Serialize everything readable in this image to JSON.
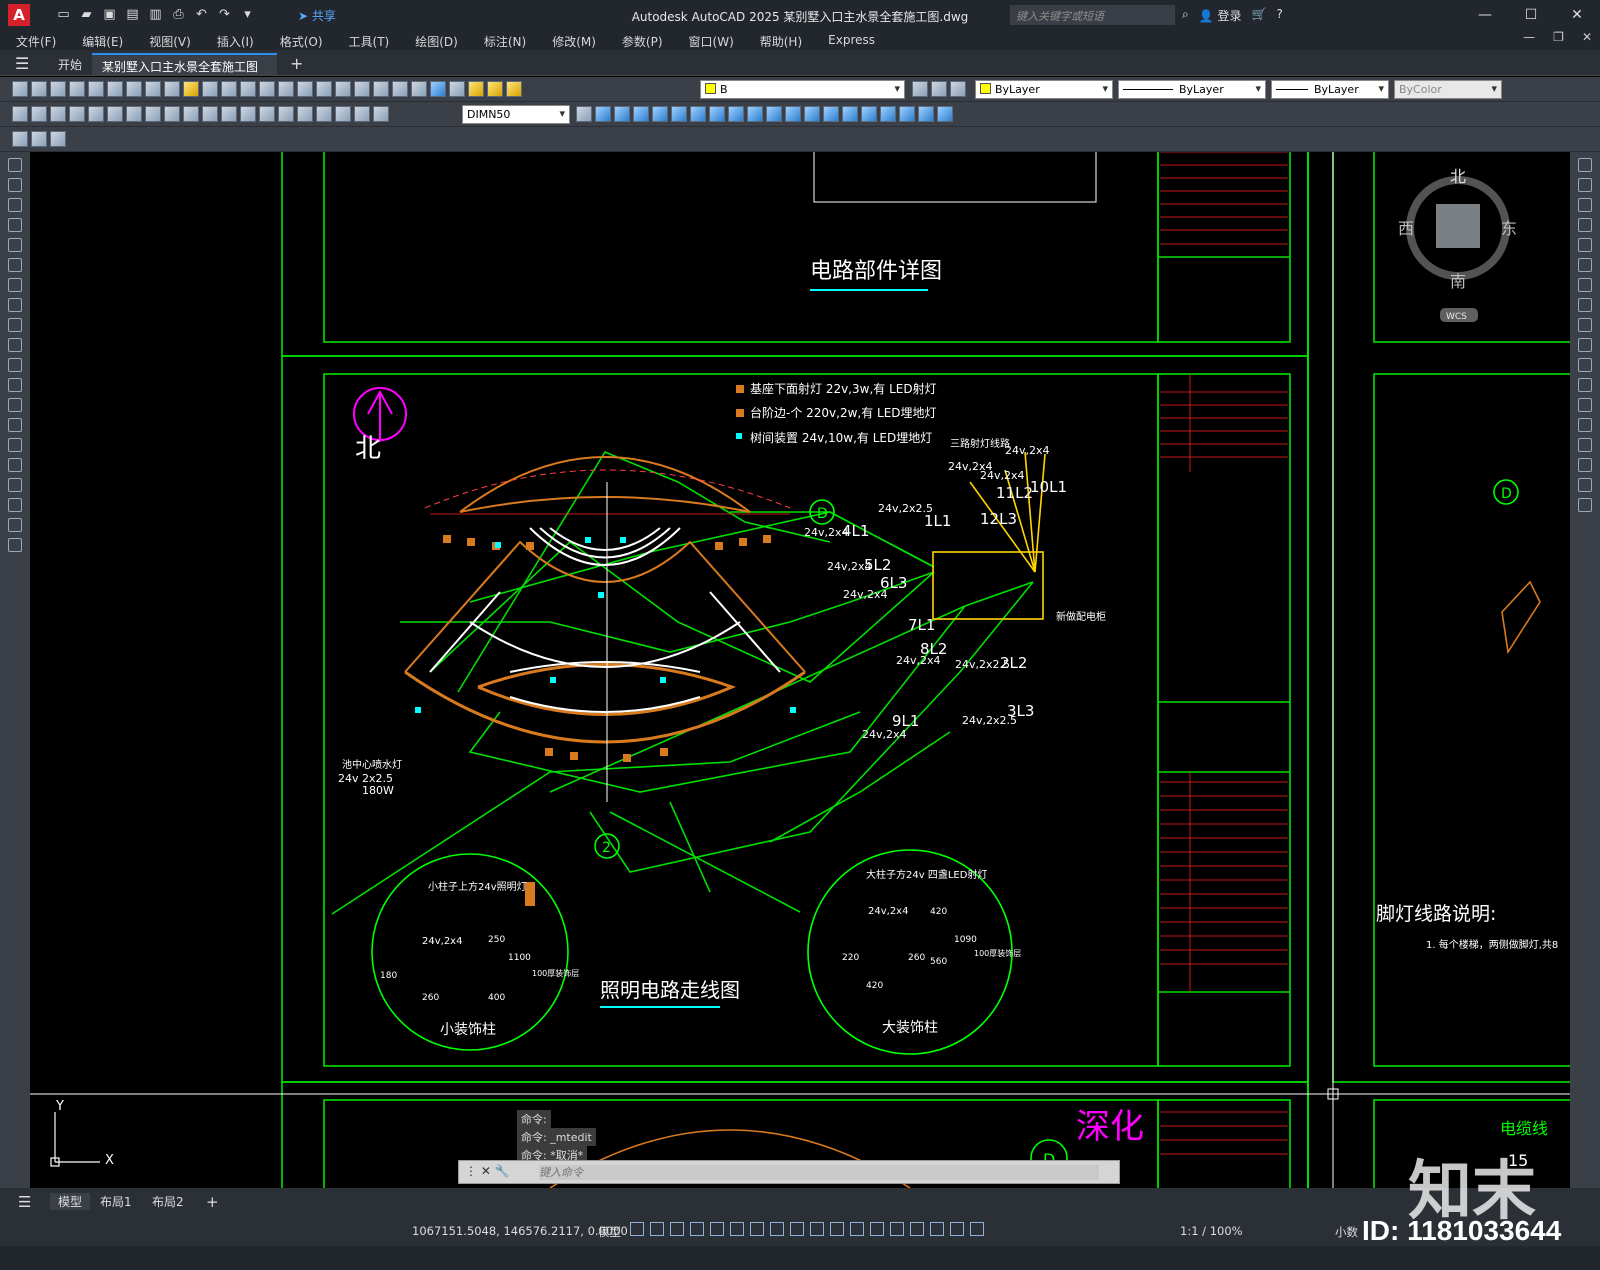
{
  "app": {
    "title": "Autodesk AutoCAD 2025    某别墅入口主水景全套施工图.dwg",
    "logo": "A",
    "share_label": "共享",
    "search_placeholder": "键入关键字或短语",
    "login_label": "登录"
  },
  "menu": [
    "文件(F)",
    "编辑(E)",
    "视图(V)",
    "插入(I)",
    "格式(O)",
    "工具(T)",
    "绘图(D)",
    "标注(N)",
    "修改(M)",
    "参数(P)",
    "窗口(W)",
    "帮助(H)",
    "Express"
  ],
  "doc_tabs": {
    "start": "开始",
    "active": "某别墅入口主水景全套施工图*"
  },
  "toolbar": {
    "layer_name": "B",
    "color": "ByLayer",
    "linetype": "ByLayer",
    "lineweight": "ByLayer",
    "plotstyle": "ByColor",
    "dimstyle": "DIMN50"
  },
  "drawing": {
    "title_main": "照明电路走线图",
    "title_top": "电路部件详图",
    "north": "北",
    "legend": [
      "基座下面射灯 22v,3w,有 LED射灯",
      "台阶边-个 220v,2w,有 LED埋地灯",
      "树间装置 24v,10w,有 LED埋地灯"
    ],
    "cable_labels": [
      "三路射灯线路",
      "24v,2x4",
      "24v,2x4",
      "24v,2x4",
      "10L1",
      "11L2",
      "12L3",
      "1L1",
      "24v,2x2.5",
      "4L1",
      "24v,2x4",
      "5L2",
      "24v,2x4",
      "6L3",
      "24v,2x4",
      "7L1",
      "8L2",
      "24v,2x4",
      "2L2",
      "24v,2x2.5",
      "9L1",
      "24v,2x4",
      "3L3",
      "24v,2x2.5"
    ],
    "panel_label": "新做配电柜",
    "fountain_note": [
      "池中心喷水灯",
      "24v 2x2.5",
      "180W"
    ],
    "detail_small": {
      "title": "小柱子上方24v照明灯",
      "caption": "小装饰柱",
      "dims": [
        "24v,2x4",
        "250",
        "1100",
        "180",
        "260",
        "400",
        "100厚装饰层"
      ]
    },
    "detail_large": {
      "title": "大柱子方24v 四盏LED射灯",
      "caption": "大装饰柱",
      "dims": [
        "24v,2x4",
        "420",
        "1090",
        "220",
        "260",
        "560",
        "420",
        "100厚装饰层"
      ]
    },
    "circle_marks": [
      "D",
      "2",
      "D",
      "D"
    ],
    "right_title": "脚灯线路说明:",
    "right_note": "1. 每个楼梯，两侧做脚灯,共8",
    "compass": {
      "n": "北",
      "w": "西",
      "e": "东",
      "s": "南",
      "wcs": "WCS"
    },
    "deepen": "深化",
    "bottom_right_label": "电缆线",
    "bottom_right_num": "15"
  },
  "command_history": [
    "命令:",
    "命令: _mtedit",
    "命令: *取消*"
  ],
  "command_placeholder": "键入命令",
  "layout_tabs": [
    "模型",
    "布局1",
    "布局2"
  ],
  "status": {
    "coords": "1067151.5048, 146576.2117, 0.0000",
    "space": "模型",
    "scale": "1:1 / 100%",
    "units": "小数"
  },
  "watermark": {
    "brand": "知末",
    "id": "ID: 1181033644"
  },
  "colors": {
    "green": "#00ff00",
    "orange": "#d87a1e",
    "yellow": "#ffff00",
    "cyan": "#00ffff",
    "red": "#ff0000",
    "magenta": "#ff00ff",
    "white": "#ffffff"
  }
}
